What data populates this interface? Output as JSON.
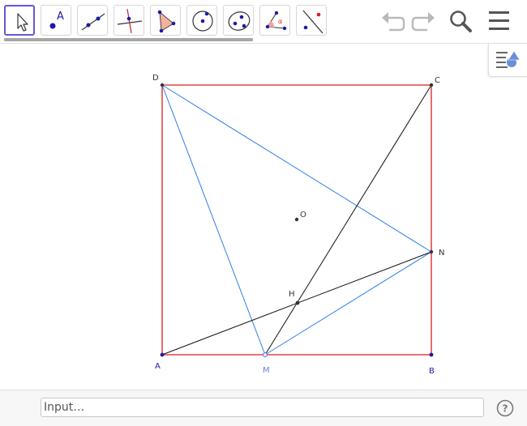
{
  "toolbar": {
    "tools": [
      {
        "icon": "move-arrow-icon",
        "selected": true
      },
      {
        "icon": "point-icon",
        "glyph": "A"
      },
      {
        "icon": "line-icon"
      },
      {
        "icon": "perpendicular-line-icon"
      },
      {
        "icon": "polygon-icon"
      },
      {
        "icon": "circle-center-point-icon"
      },
      {
        "icon": "conic-ellipse-icon"
      },
      {
        "icon": "angle-icon",
        "glyph": "α"
      },
      {
        "icon": "reflect-about-line-icon"
      }
    ],
    "undo": "undo-icon",
    "redo": "redo-icon",
    "search": "search-icon",
    "menu": "hamburger-menu-icon"
  },
  "style_bar": {
    "icon": "style-bar-toggle-icon"
  },
  "construction": {
    "points": {
      "A": {
        "label": "A",
        "color": "#1a1aa8"
      },
      "B": {
        "label": "B",
        "color": "#1a1aa8"
      },
      "C": {
        "label": "C",
        "color": "#333333"
      },
      "D": {
        "label": "D",
        "color": "#333333"
      },
      "M": {
        "label": "M",
        "color": "#6c7fd8"
      },
      "N": {
        "label": "N",
        "color": "#333333"
      },
      "O": {
        "label": "O",
        "color": "#333333"
      },
      "H": {
        "label": "H",
        "color": "#333333"
      }
    },
    "colors": {
      "square": "#e01b1b",
      "triangle": "#2f7fe8",
      "lines": "#111111"
    }
  },
  "input_bar": {
    "placeholder": "Input…",
    "value": ""
  },
  "help": {
    "glyph": "?"
  }
}
